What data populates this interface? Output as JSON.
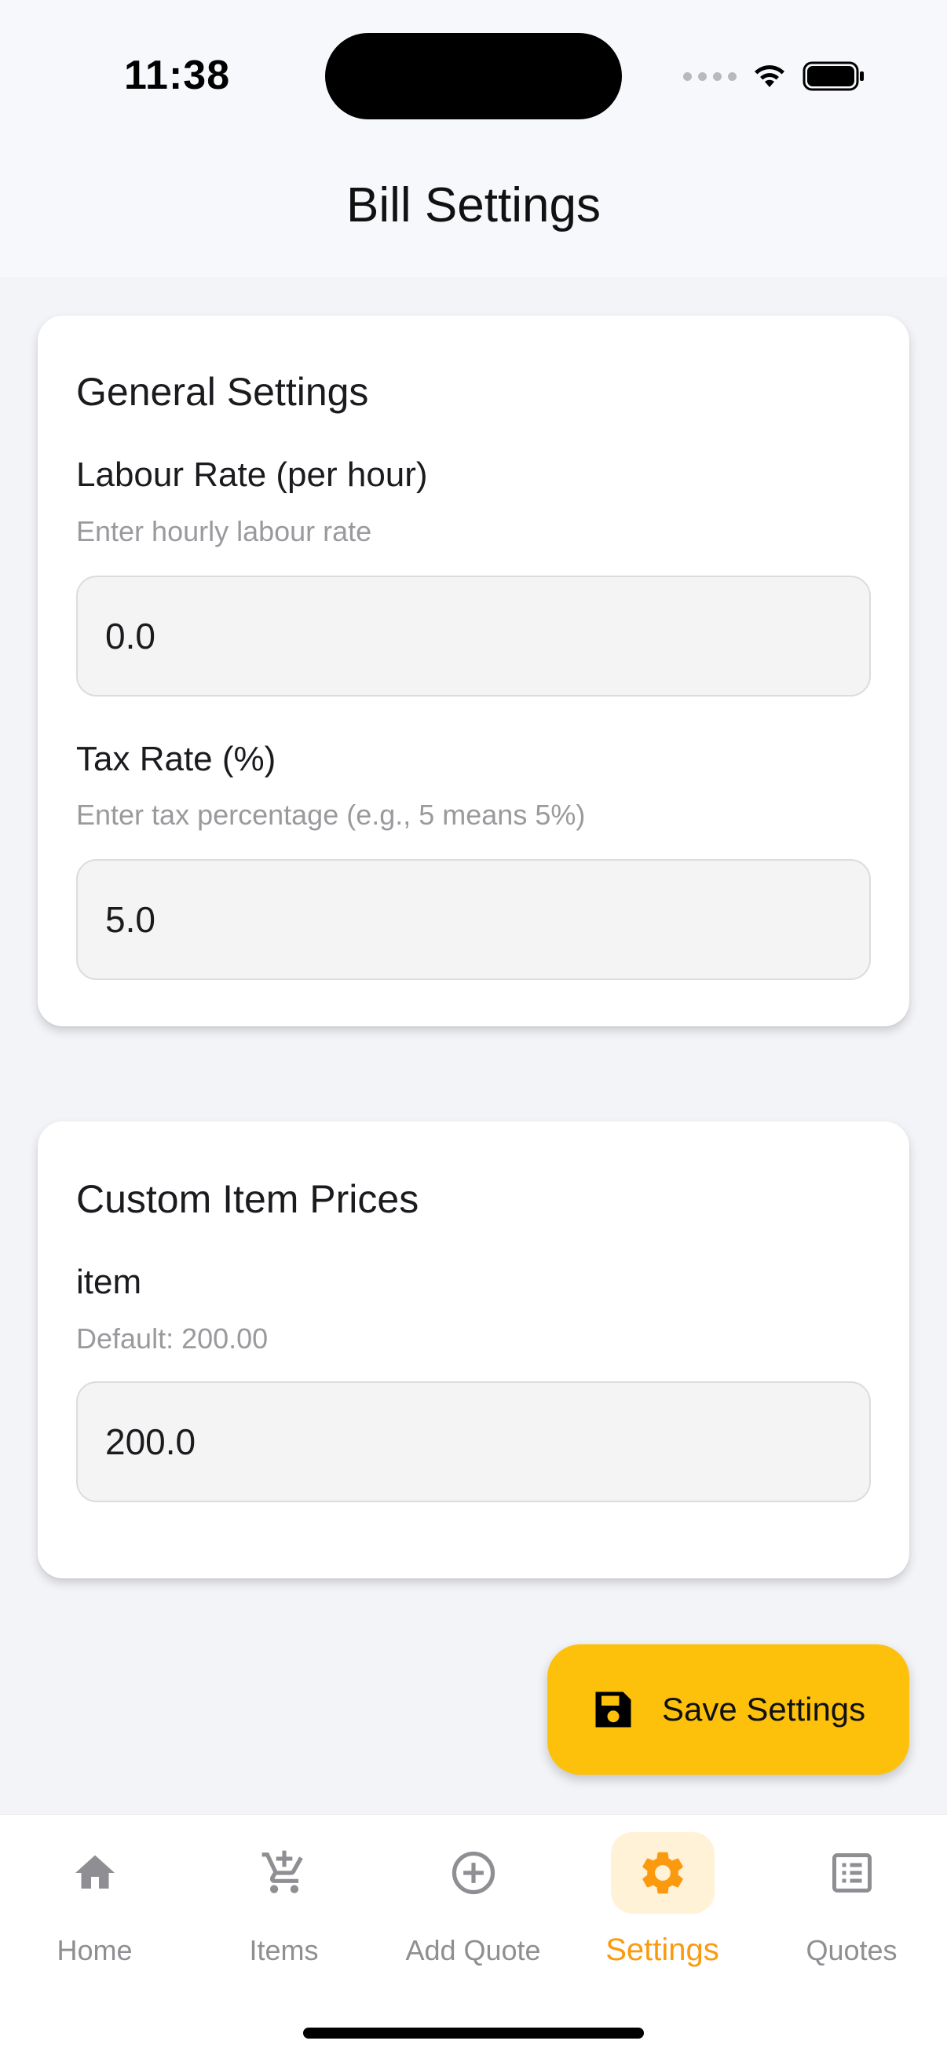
{
  "status_bar": {
    "time": "11:38"
  },
  "app_bar": {
    "title": "Bill Settings"
  },
  "general_settings": {
    "title": "General Settings",
    "labour_rate": {
      "label": "Labour Rate (per hour)",
      "help": "Enter hourly labour rate",
      "value": "0.0"
    },
    "tax_rate": {
      "label": "Tax Rate (%)",
      "help": "Enter tax percentage (e.g., 5 means 5%)",
      "value": "5.0"
    }
  },
  "custom_prices": {
    "title": "Custom Item Prices",
    "items": [
      {
        "name": "item",
        "default": "Default: 200.00",
        "value": "200.0"
      }
    ]
  },
  "save_button": {
    "label": "Save Settings",
    "icon": "save-icon"
  },
  "bottom_nav": {
    "active": "Settings",
    "items": [
      {
        "label": "Home",
        "icon": "home-icon"
      },
      {
        "label": "Items",
        "icon": "add-cart-icon"
      },
      {
        "label": "Add Quote",
        "icon": "add-circle-icon"
      },
      {
        "label": "Settings",
        "icon": "gear-icon"
      },
      {
        "label": "Quotes",
        "icon": "list-icon"
      }
    ]
  },
  "colors": {
    "accent": "#FDC10C",
    "active_nav": "#FB9A0E",
    "active_nav_bg": "#FFF2D6"
  }
}
